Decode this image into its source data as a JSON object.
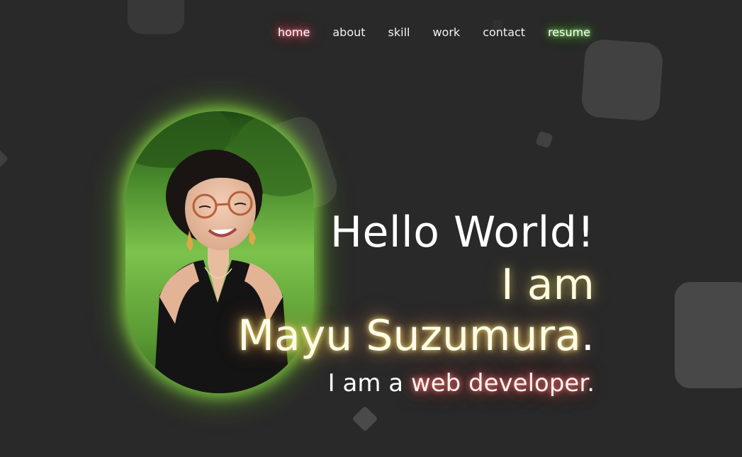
{
  "nav": {
    "items": [
      {
        "label": "home"
      },
      {
        "label": "about"
      },
      {
        "label": "skill"
      },
      {
        "label": "work"
      },
      {
        "label": "contact"
      },
      {
        "label": "resume"
      }
    ]
  },
  "hero": {
    "greeting": "Hello World!",
    "i_am": "I am",
    "name": "Mayu Suzumura",
    "name_period": ".",
    "role_prefix": "I am a ",
    "role": "web developer",
    "role_period": "."
  },
  "colors": {
    "background": "#292929",
    "nav_home_glow": "#ff5566",
    "nav_resume_glow": "#66dd44",
    "photo_glow": "#a0ff50",
    "name_glow": "#ffe878",
    "role_glow": "#ff5050"
  },
  "photo": {
    "icon": "profile-portrait"
  }
}
